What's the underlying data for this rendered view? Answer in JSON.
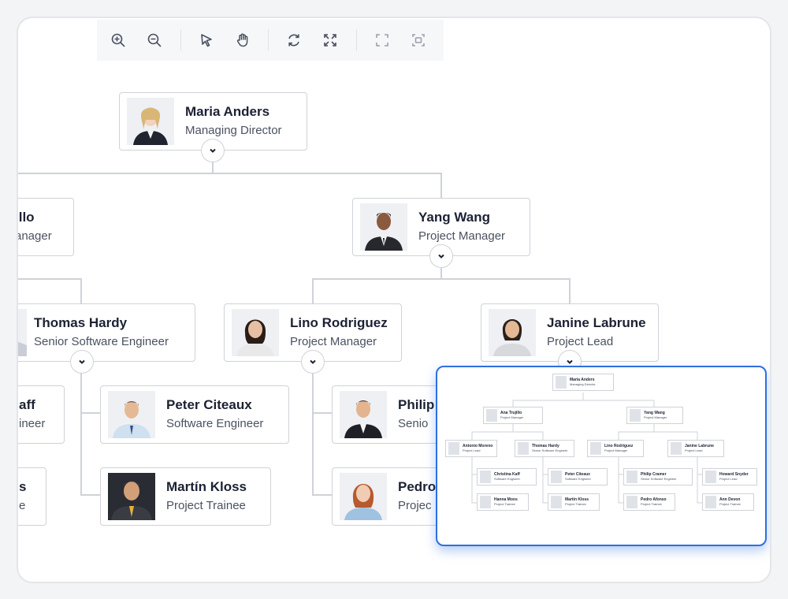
{
  "toolbar": {
    "buttons": [
      {
        "icon": "zoom-in-icon"
      },
      {
        "icon": "zoom-out-icon"
      },
      {
        "icon": "select-pointer-icon"
      },
      {
        "icon": "pan-hand-icon"
      },
      {
        "icon": "reset-rotate-icon"
      },
      {
        "icon": "fit-to-page-icon"
      },
      {
        "icon": "fullscreen-icon"
      },
      {
        "icon": "center-view-icon"
      }
    ]
  },
  "chart": {
    "maria": {
      "name": "Maria Anders",
      "role": "Managing Director"
    },
    "ana": {
      "name": "illo",
      "role": "anager"
    },
    "yang": {
      "name": "Yang Wang",
      "role": "Project Manager"
    },
    "thomas": {
      "name": "Thomas Hardy",
      "role": "Senior Software Engineer"
    },
    "lino": {
      "name": "Lino Rodriguez",
      "role": "Project Manager"
    },
    "janine": {
      "name": "Janine Labrune",
      "role": "Project Lead"
    },
    "christina": {
      "name": "aff",
      "role": "ineer"
    },
    "peter": {
      "name": "Peter Citeaux",
      "role": "Software Engineer"
    },
    "philip": {
      "name": "Philip",
      "role": "Senio"
    },
    "hanna": {
      "name": "s",
      "role": "e"
    },
    "martin": {
      "name": "Martín Kloss",
      "role": "Project Trainee"
    },
    "pedro": {
      "name": "Pedro",
      "role": "Projec"
    }
  },
  "overview": {
    "nodes": [
      {
        "name": "Maria Anders",
        "role": "Managing Director"
      },
      {
        "name": "Ana Trujillo",
        "role": "Project Manager"
      },
      {
        "name": "Yang Wang",
        "role": "Project Manager"
      },
      {
        "name": "Antonio Moreno",
        "role": "Project Lead"
      },
      {
        "name": "Thomas Hardy",
        "role": "Senior Software Engineer"
      },
      {
        "name": "Lino Rodriguez",
        "role": "Project Manager"
      },
      {
        "name": "Janine Labrune",
        "role": "Project Lead"
      },
      {
        "name": "Christina Kaff",
        "role": "Software Engineer"
      },
      {
        "name": "Peter Citeaux",
        "role": "Software Engineer"
      },
      {
        "name": "Philip Cramer",
        "role": "Senior Software Engineer"
      },
      {
        "name": "Howard Snyder",
        "role": "Project Lead"
      },
      {
        "name": "Hanna Moos",
        "role": "Project Trainee"
      },
      {
        "name": "Martin Kloss",
        "role": "Project Trainee"
      },
      {
        "name": "Pedro Afonso",
        "role": "Project Trainee"
      },
      {
        "name": "Ann Devon",
        "role": "Project Trainee"
      }
    ]
  }
}
